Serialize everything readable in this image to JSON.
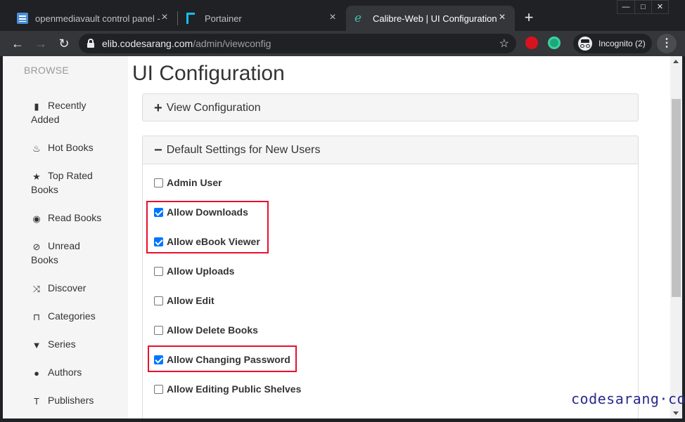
{
  "browser": {
    "tabs": [
      {
        "title": "openmediavault control panel - c",
        "active": false
      },
      {
        "title": "Portainer",
        "active": false
      },
      {
        "title": "Calibre-Web | UI Configuration",
        "active": true
      }
    ],
    "url_host": "elib.codesarang.com",
    "url_path": "/admin/viewconfig",
    "incognito_label": "Incognito (2)"
  },
  "sidebar": {
    "heading": "BROWSE",
    "items": [
      {
        "line1": "Recently",
        "line2": "Added",
        "icon": "book-icon"
      },
      {
        "line1": "Hot Books",
        "line2": "",
        "icon": "fire-icon"
      },
      {
        "line1": "Top Rated",
        "line2": "Books",
        "icon": "star-icon"
      },
      {
        "line1": "Read Books",
        "line2": "",
        "icon": "eye-icon"
      },
      {
        "line1": "Unread",
        "line2": "Books",
        "icon": "eye-slash-icon"
      },
      {
        "line1": "Discover",
        "line2": "",
        "icon": "shuffle-icon"
      },
      {
        "line1": "Categories",
        "line2": "",
        "icon": "inbox-icon"
      },
      {
        "line1": "Series",
        "line2": "",
        "icon": "bookmark-icon"
      },
      {
        "line1": "Authors",
        "line2": "",
        "icon": "user-icon"
      },
      {
        "line1": "Publishers",
        "line2": "",
        "icon": "text-icon"
      }
    ]
  },
  "main": {
    "title": "UI Configuration",
    "panel_view": "View Configuration",
    "panel_defaults": "Default Settings for New Users",
    "options": [
      {
        "label": "Admin User",
        "checked": false
      },
      {
        "label": "Allow Downloads",
        "checked": true
      },
      {
        "label": "Allow eBook Viewer",
        "checked": true
      },
      {
        "label": "Allow Uploads",
        "checked": false
      },
      {
        "label": "Allow Edit",
        "checked": false
      },
      {
        "label": "Allow Delete Books",
        "checked": false
      },
      {
        "label": "Allow Changing Password",
        "checked": true
      },
      {
        "label": "Allow Editing Public Shelves",
        "checked": false
      }
    ]
  },
  "watermark": "codesarang·com",
  "colors": {
    "highlight": "#e8102c",
    "checkbox": "#0075ff"
  }
}
